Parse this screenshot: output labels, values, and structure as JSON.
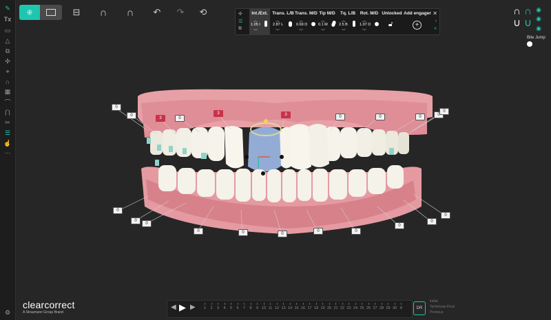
{
  "left_toolbar": {
    "icons": [
      "pencil-icon",
      "tx-icon",
      "rectangle-icon",
      "triangle-icon",
      "square-outline-icon",
      "copy-icon",
      "move-icon",
      "attach-icon",
      "arch-icon",
      "grid-icon",
      "arch-outline-icon",
      "arch-bracket-icon",
      "scalpel-icon",
      "bars-icon",
      "pointer-icon",
      "more-icon",
      "settings-icon"
    ],
    "tx_label": "Tx"
  },
  "top_toolbar": {
    "icons": [
      "select-teeth-icon",
      "single-view-icon",
      "ruler-icon",
      "upper-arch-icon",
      "lower-arch-icon",
      "undo-icon",
      "redo-icon",
      "reset-icon"
    ]
  },
  "move_panel": {
    "columns": [
      {
        "header": "Int./Ext.",
        "value": "1.05 I"
      },
      {
        "header": "Trans. L/B",
        "value": "2.87 L"
      },
      {
        "header": "Trans. M/D",
        "value": "0.69 D"
      },
      {
        "header": "Tip M/D",
        "value": "0.1 M"
      },
      {
        "header": "Tq. L/B",
        "value": "2.5 B"
      },
      {
        "header": "Rot. M/D",
        "value": "1.07 D"
      }
    ],
    "unlocked_label": "Unlocked",
    "add_engager_label": "Add engager",
    "close_icon": "close-icon"
  },
  "right_panel": {
    "bite_jump_label": "Bite Jump",
    "accent": "#1ec6b0"
  },
  "tooth_labels": [
    {
      "text": "0",
      "kind": "normal"
    },
    {
      "text": "0",
      "kind": "normal"
    },
    {
      "text": "3",
      "kind": "red"
    },
    {
      "text": "0",
      "kind": "normal"
    },
    {
      "text": "3",
      "kind": "red"
    },
    {
      "text": "3",
      "kind": "red"
    },
    {
      "text": "0",
      "kind": "normal"
    },
    {
      "text": "0",
      "kind": "normal"
    },
    {
      "text": "0",
      "kind": "normal"
    },
    {
      "text": "0",
      "kind": "normal"
    },
    {
      "text": "0",
      "kind": "normal"
    },
    {
      "text": "0",
      "kind": "normal"
    },
    {
      "text": "0",
      "kind": "normal"
    },
    {
      "text": "0",
      "kind": "normal"
    },
    {
      "text": "0",
      "kind": "normal"
    },
    {
      "text": "0",
      "kind": "normal"
    },
    {
      "text": "0",
      "kind": "normal"
    },
    {
      "text": "0",
      "kind": "normal"
    },
    {
      "text": "0",
      "kind": "normal"
    },
    {
      "text": "0",
      "kind": "normal"
    },
    {
      "text": "0",
      "kind": "normal"
    },
    {
      "text": "0",
      "kind": "normal"
    },
    {
      "text": "0",
      "kind": "normal"
    }
  ],
  "brand": {
    "name": "clearcorrect",
    "tagline": "A Straumann Group Brand"
  },
  "timeline": {
    "stages": [
      "1",
      "2",
      "3",
      "4",
      "5",
      "6",
      "7",
      "8",
      "9",
      "10",
      "11",
      "12",
      "13",
      "14",
      "15",
      "16",
      "17",
      "18",
      "19",
      "20",
      "21",
      "22",
      "23",
      "24",
      "25",
      "26",
      "27",
      "28",
      "29",
      "30",
      "8"
    ],
    "dr_badge": "DR",
    "legend": [
      "Initial",
      "Technician Final",
      "Previous"
    ]
  },
  "colors": {
    "gum": "#e99aa3",
    "tooth": "#f2f0e6",
    "selected_tooth": "#8eaad6",
    "accent": "#1ec6b0",
    "label_red": "#c8334a"
  }
}
